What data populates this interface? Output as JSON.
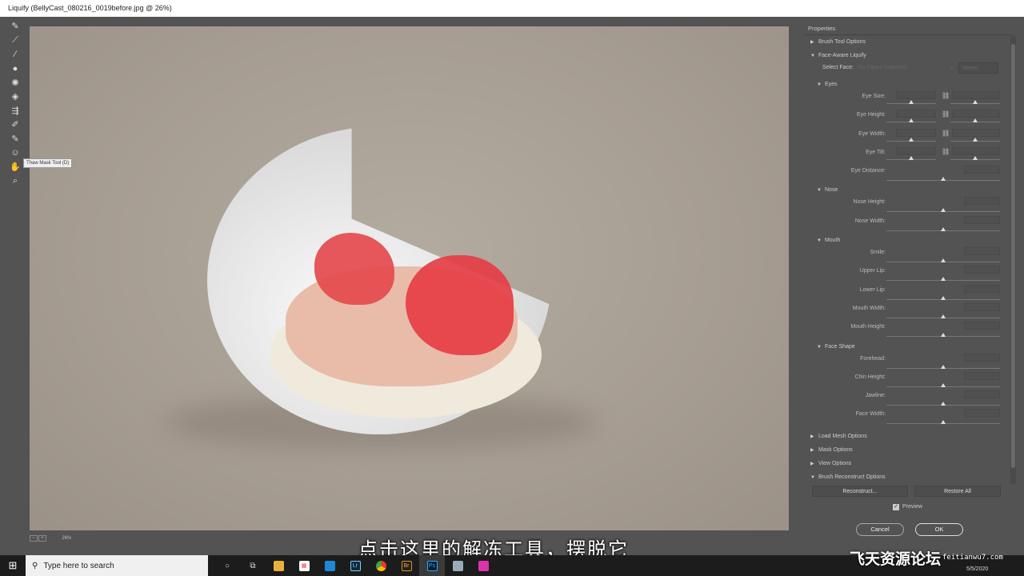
{
  "window": {
    "title": "Liquify (BellyCast_080216_0019before.jpg @ 26%)"
  },
  "toolbar": {
    "tooltip": "Thaw Mask Tool (D)",
    "tools": [
      "forward-warp",
      "reconstruct",
      "smooth",
      "twirl",
      "pucker",
      "bloat",
      "push-left",
      "freeze-mask",
      "thaw-mask",
      "face",
      "hand",
      "zoom"
    ]
  },
  "panel": {
    "title": "Properties",
    "brush_tool_options": "Brush Tool Options",
    "face_aware": "Face-Aware Liquify",
    "select_face_label": "Select Face:",
    "select_face_value": "No Faces Detected",
    "reset": "Reset",
    "groups": [
      {
        "name": "Eyes",
        "rows": [
          {
            "label": "Eye Size:",
            "pair": true
          },
          {
            "label": "Eye Height:",
            "pair": true
          },
          {
            "label": "Eye Width:",
            "pair": true
          },
          {
            "label": "Eye Tilt:",
            "pair": true
          },
          {
            "label": "Eye Distance:",
            "pair": false
          }
        ]
      },
      {
        "name": "Nose",
        "rows": [
          {
            "label": "Nose Height:",
            "pair": false
          },
          {
            "label": "Nose Width:",
            "pair": false
          }
        ]
      },
      {
        "name": "Mouth",
        "rows": [
          {
            "label": "Smile:",
            "pair": false
          },
          {
            "label": "Upper Lip:",
            "pair": false
          },
          {
            "label": "Lower Lip:",
            "pair": false
          },
          {
            "label": "Mouth Width:",
            "pair": false
          },
          {
            "label": "Mouth Height:",
            "pair": false
          }
        ]
      },
      {
        "name": "Face Shape",
        "rows": [
          {
            "label": "Forehead:",
            "pair": false
          },
          {
            "label": "Chin Height:",
            "pair": false
          },
          {
            "label": "Jawline:",
            "pair": false
          },
          {
            "label": "Face Width:",
            "pair": false
          }
        ]
      }
    ],
    "load_mesh": "Load Mesh Options",
    "mask_options": "Mask Options",
    "view_options": "View Options",
    "brush_reconstruct": "Brush Reconstruct Options",
    "reconstruct": "Reconstruct...",
    "restore_all": "Restore All",
    "preview": "Preview",
    "cancel": "Cancel",
    "ok": "OK"
  },
  "status": {
    "zoom": "26%"
  },
  "subtitle": "点击这里的解冻工具，摆脱它",
  "watermark": {
    "cn": "飞天资源论坛",
    "url": "feitianwu7.com"
  },
  "taskbar": {
    "search_placeholder": "Type here to search",
    "apps": [
      "Lr",
      "Br",
      "Ps"
    ],
    "date": "5/5/2020"
  }
}
